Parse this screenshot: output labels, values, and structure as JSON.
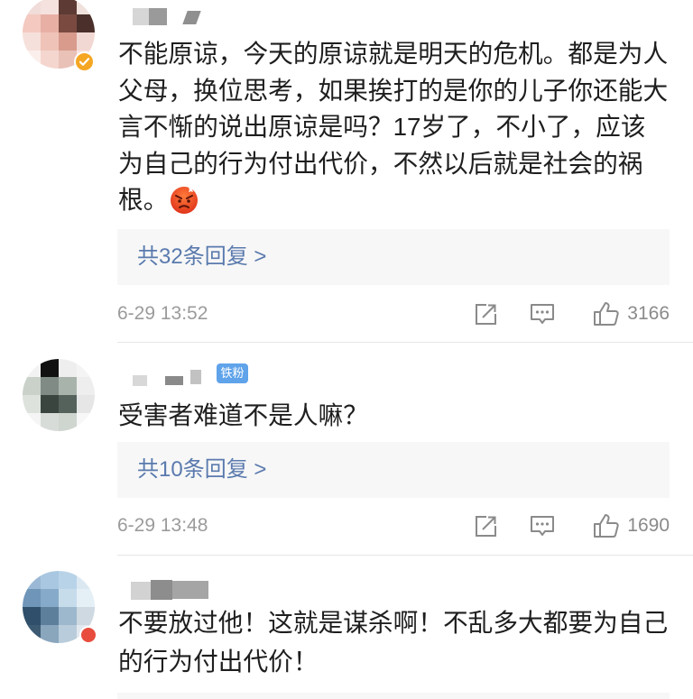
{
  "colors": {
    "link": "#5a7aae",
    "badge_fan": "#5fa3ea",
    "verified": "#f5a623",
    "text": "#1e1e1e",
    "meta": "#9b9b9b"
  },
  "icons": {
    "share": "share-icon",
    "comment": "comment-icon",
    "like": "thumbs-up-icon",
    "emoji": "angry-face-emoji",
    "verified": "verified-badge-icon"
  },
  "comments": [
    {
      "text_lines": [
        "不能原谅，今天的原谅就是明天的危机。都是为人",
        "父母，换位思考，如果挨打的是你的儿子你还能大",
        "言不惭的说出原谅是吗？17岁了，不小了，应该",
        "为自己的行为付出代价，不然以后就是社会的祸",
        "根。"
      ],
      "reply_label": "共32条回复 >",
      "timestamp": "6-29 13:52",
      "like_count": "3166"
    },
    {
      "fan_badge": "铁粉",
      "text_lines": [
        "受害者难道不是人嘛？"
      ],
      "reply_label": "共10条回复 >",
      "timestamp": "6-29 13:48",
      "like_count": "1690"
    },
    {
      "text_lines": [
        "不要放过他！这就是谋杀啊！不乱多大都要为自己",
        "的行为付出代价！"
      ]
    }
  ]
}
